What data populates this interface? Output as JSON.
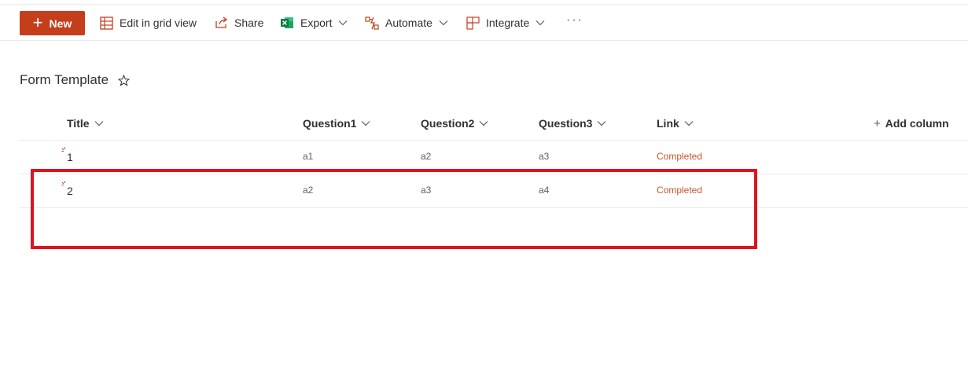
{
  "toolbar": {
    "new_label": "New",
    "edit_grid_label": "Edit in grid view",
    "share_label": "Share",
    "export_label": "Export",
    "automate_label": "Automate",
    "integrate_label": "Integrate",
    "more_label": "···"
  },
  "list": {
    "title": "Form Template",
    "columns": [
      "Title",
      "Question1",
      "Question2",
      "Question3",
      "Link"
    ],
    "add_column_label": "Add column",
    "rows": [
      {
        "title": "1",
        "q1": "a1",
        "q2": "a2",
        "q3": "a3",
        "link": "Completed"
      },
      {
        "title": "2",
        "q1": "a2",
        "q2": "a3",
        "q3": "a4",
        "link": "Completed"
      }
    ]
  },
  "colors": {
    "accent": "#c43e1c",
    "link": "#c4562b",
    "highlight": "#e1121d",
    "excel": "#107c41"
  },
  "icons": [
    "plus-icon",
    "grid-icon",
    "share-icon",
    "excel-icon",
    "automate-icon",
    "integrate-icon",
    "more-icon",
    "star-icon",
    "chevron-down-icon",
    "new-item-icon"
  ]
}
